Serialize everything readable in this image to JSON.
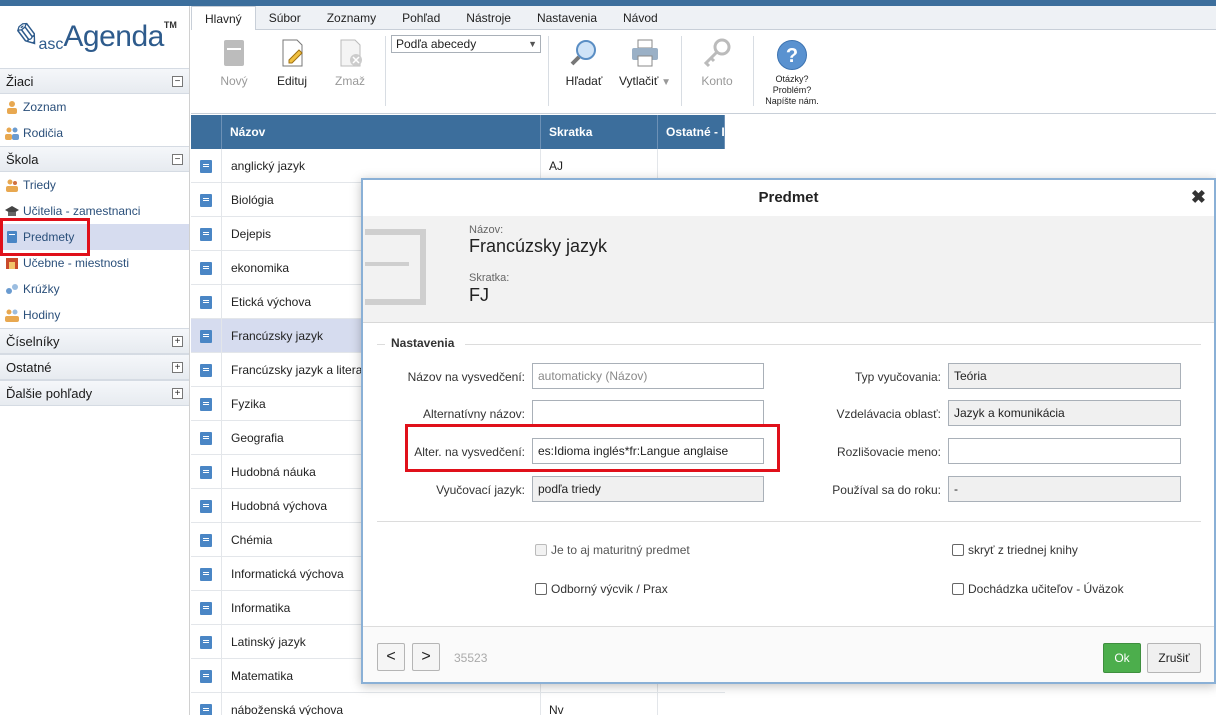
{
  "app": {
    "logo_prefix": "asc",
    "logo_name": "Agenda",
    "logo_tm": "TM"
  },
  "sidebar": {
    "sections": [
      {
        "label": "Žiaci",
        "toggle": "−",
        "items": [
          {
            "label": "Zoznam"
          },
          {
            "label": "Rodičia"
          }
        ]
      },
      {
        "label": "Škola",
        "toggle": "−",
        "items": [
          {
            "label": "Triedy"
          },
          {
            "label": "Učitelia - zamestnanci"
          },
          {
            "label": "Predmety"
          },
          {
            "label": "Učebne - miestnosti"
          },
          {
            "label": "Krúžky"
          },
          {
            "label": "Hodiny"
          }
        ]
      },
      {
        "label": "Číselníky",
        "toggle": "+"
      },
      {
        "label": "Ostatné",
        "toggle": "+"
      },
      {
        "label": "Ďalšie pohľady",
        "toggle": "+"
      }
    ]
  },
  "ribbon": {
    "tabs": [
      "Hlavný",
      "Súbor",
      "Zoznamy",
      "Pohľad",
      "Nástroje",
      "Nastavenia",
      "Návod"
    ],
    "new_label": "Nový",
    "edit_label": "Edituj",
    "delete_label": "Zmaž",
    "sort_value": "Podľa abecedy",
    "search_label": "Hľadať",
    "print_label": "Vytlačiť",
    "account_label": "Konto",
    "help_line1": "Otázky?",
    "help_line2": "Problém?",
    "help_line3": "Napíšte nám."
  },
  "grid": {
    "columns": [
      "Názov",
      "Skratka",
      "Ostatné - I"
    ],
    "rows": [
      {
        "name": "anglický jazyk",
        "short": "AJ"
      },
      {
        "name": "Biológia",
        "short": ""
      },
      {
        "name": "Dejepis",
        "short": ""
      },
      {
        "name": "ekonomika",
        "short": ""
      },
      {
        "name": "Etická výchova",
        "short": ""
      },
      {
        "name": "Francúzsky jazyk",
        "short": ""
      },
      {
        "name": "Francúzsky jazyk a literatúra",
        "short": ""
      },
      {
        "name": "Fyzika",
        "short": ""
      },
      {
        "name": "Geografia",
        "short": ""
      },
      {
        "name": "Hudobná náuka",
        "short": ""
      },
      {
        "name": "Hudobná výchova",
        "short": ""
      },
      {
        "name": "Chémia",
        "short": ""
      },
      {
        "name": "Informatická výchova",
        "short": ""
      },
      {
        "name": "Informatika",
        "short": ""
      },
      {
        "name": "Latinský jazyk",
        "short": ""
      },
      {
        "name": "Matematika",
        "short": ""
      },
      {
        "name": "náboženská výchova",
        "short": "Nv"
      }
    ]
  },
  "dialog": {
    "title": "Predmet",
    "close": "✖",
    "name_label": "Názov:",
    "name_value": "Francúzsky jazyk",
    "short_label": "Skratka:",
    "short_value": "FJ",
    "section_label": "Nastavenia",
    "fields_left": [
      {
        "label": "Názov na vysvedčení:",
        "value": "",
        "placeholder": "automaticky (Názov)"
      },
      {
        "label": "Alternatívny názov:",
        "value": ""
      },
      {
        "label": "Alter. na vysvedčení:",
        "value": "es:Idioma inglés*fr:Langue anglaise"
      },
      {
        "label": "Vyučovací jazyk:",
        "value": "podľa triedy"
      }
    ],
    "fields_right": [
      {
        "label": "Typ vyučovania:",
        "value": "Teória"
      },
      {
        "label": "Vzdelávacia oblasť:",
        "value": "Jazyk a komunikácia"
      },
      {
        "label": "Rozlišovacie meno:",
        "value": ""
      },
      {
        "label": "Používal sa do roku:",
        "value": "-"
      }
    ],
    "checkboxes": {
      "maturita": "Je to aj maturitný predmet",
      "hide_book": "skryť z triednej knihy",
      "vocational": "Odborný výcvik / Prax",
      "attendance": "Dochádzka učiteľov - Úväzok"
    },
    "prev": "<",
    "next": ">",
    "record_id": "35523",
    "ok_label": "Ok",
    "cancel_label": "Zrušiť"
  },
  "colors": {
    "header_blue": "#3c6e9c",
    "highlight_red": "#e0101a",
    "ok_green": "#4cae4c",
    "selected_row": "#d6dcef"
  }
}
